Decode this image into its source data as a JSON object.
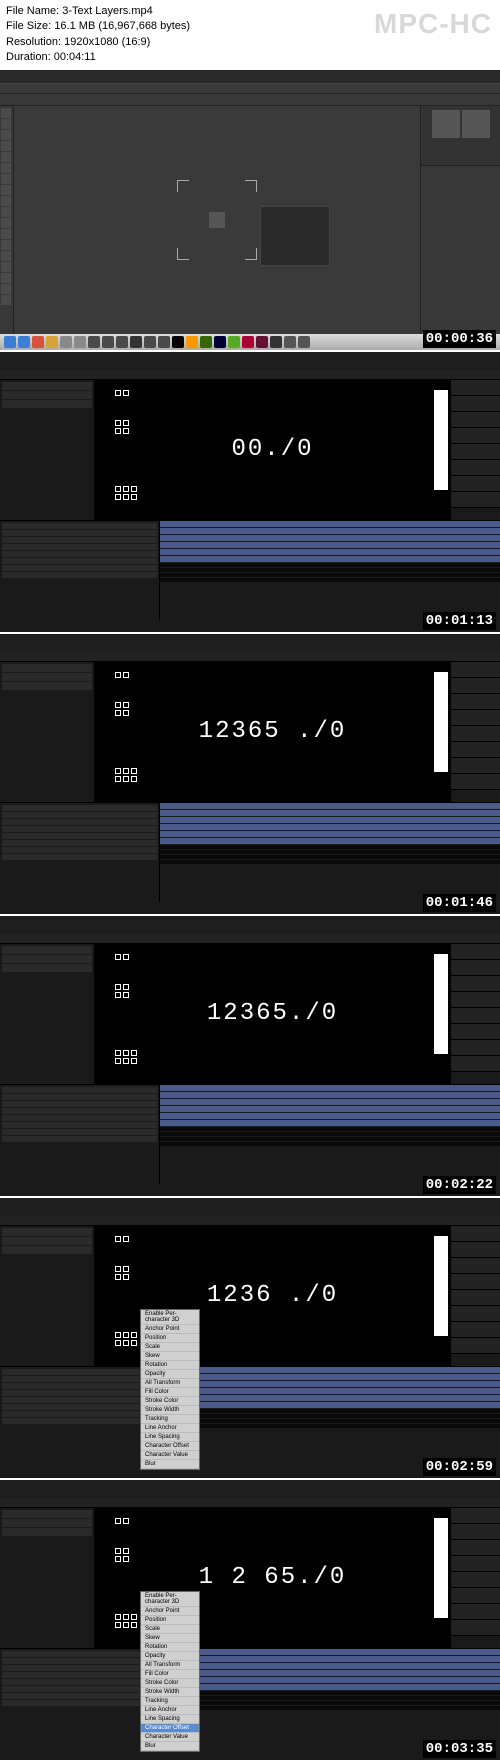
{
  "header": {
    "file_name_label": "File Name:",
    "file_name": "3-Text Layers.mp4",
    "file_size_label": "File Size:",
    "file_size": "16.1 MB (16,967,668 bytes)",
    "resolution_label": "Resolution:",
    "resolution": "1920x1080 (16:9)",
    "duration_label": "Duration:",
    "duration": "00:04:11",
    "watermark": "MPC-HC"
  },
  "frames": [
    {
      "type": "ps",
      "timestamp": "00:00:36"
    },
    {
      "type": "ae",
      "timestamp": "00:01:13",
      "text": "00./0",
      "red_idx": []
    },
    {
      "type": "ae",
      "timestamp": "00:01:46",
      "text": "12365 ./0",
      "red_idx": []
    },
    {
      "type": "ae",
      "timestamp": "00:02:22",
      "text": "12365./0",
      "red_idx": []
    },
    {
      "type": "ae",
      "timestamp": "00:02:59",
      "text": "1236 ./0",
      "red_idx": [],
      "menu": true,
      "menu_items": [
        "Enable Per-character 3D",
        "Anchor Point",
        "Position",
        "Scale",
        "Skew",
        "Rotation",
        "Opacity",
        "All Transform",
        "Fill Color",
        "Stroke Color",
        "Stroke Width",
        "Tracking",
        "Line Anchor",
        "Line Spacing",
        "Character Offset",
        "Character Value",
        "Blur"
      ]
    },
    {
      "type": "ae",
      "timestamp": "00:03:35",
      "text": "1 2 65./0",
      "red_idx": [
        1,
        3
      ],
      "menu": true,
      "menu_items": [
        "Enable Per-character 3D",
        "Anchor Point",
        "Position",
        "Scale",
        "Skew",
        "Rotation",
        "Opacity",
        "All Transform",
        "Fill Color",
        "Stroke Color",
        "Stroke Width",
        "Tracking",
        "Line Anchor",
        "Line Spacing",
        "Character Offset",
        "Character Value",
        "Blur"
      ],
      "menu_hover": "Character Offset"
    }
  ],
  "dock_colors": [
    "#3a7fd5",
    "#3a7fd5",
    "#d5533a",
    "#d5a33a",
    "#888",
    "#888",
    "#4a4a4a",
    "#4a4a4a",
    "#4a4a4a",
    "#333",
    "#4a4a4a",
    "#4a4a4a",
    "#000",
    "#f90",
    "#360",
    "#003",
    "#5a2",
    "#a03",
    "#613",
    "#333",
    "#555",
    "#555"
  ]
}
